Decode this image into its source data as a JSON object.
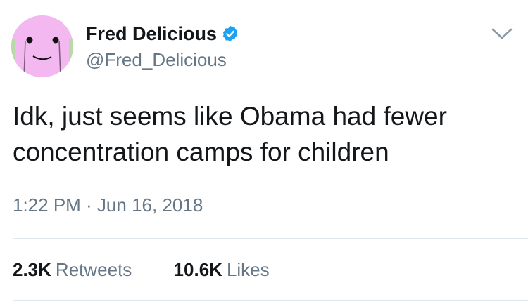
{
  "author": {
    "display_name": "Fred Delicious",
    "handle": "@Fred_Delicious",
    "verified": true
  },
  "tweet": {
    "text": "Idk, just seems like Obama had fewer concentration camps for children",
    "timestamp": "1:22 PM · Jun 16, 2018"
  },
  "stats": {
    "retweets_count": "2.3K",
    "retweets_label": "Retweets",
    "likes_count": "10.6K",
    "likes_label": "Likes"
  },
  "icons": {
    "verified": "verified-badge-icon",
    "menu": "chevron-down-icon"
  },
  "colors": {
    "verified_blue": "#1da1f2",
    "secondary_text": "#657786",
    "primary_text": "#14171a",
    "avatar_pink": "#f2b8ef"
  }
}
